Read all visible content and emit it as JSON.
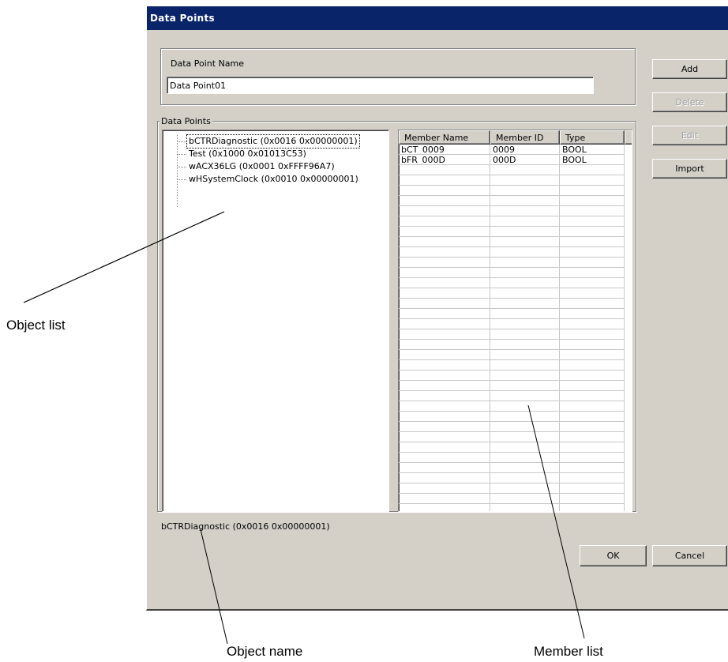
{
  "window": {
    "title": "Data Points"
  },
  "name_group": {
    "label": "Data Point Name",
    "value": "Data Point01"
  },
  "buttons": {
    "add": "Add",
    "delete": "Delete",
    "edit": "Edit",
    "import": "Import",
    "ok": "OK",
    "cancel": "Cancel"
  },
  "points_group": {
    "label": "Data Points"
  },
  "tree": {
    "items": [
      {
        "label": "bCTRDiagnostic (0x0016 0x00000001)",
        "selected": true
      },
      {
        "label": "Test (0x1000 0x01013C53)"
      },
      {
        "label": "wACX36LG (0x0001 0xFFFF96A7)"
      },
      {
        "label": "wHSystemClock (0x0010 0x00000001)"
      }
    ]
  },
  "members": {
    "columns": [
      "Member Name",
      "Member ID",
      "Type"
    ],
    "rows": [
      [
        "bCT_0009",
        "0009",
        "BOOL"
      ],
      [
        "bFR_000D",
        "000D",
        "BOOL"
      ]
    ]
  },
  "status": {
    "object_name": "bCTRDiagnostic (0x0016 0x00000001)"
  },
  "annotations": {
    "object_list": "Object list",
    "object_name": "Object name",
    "member_list": "Member list"
  }
}
